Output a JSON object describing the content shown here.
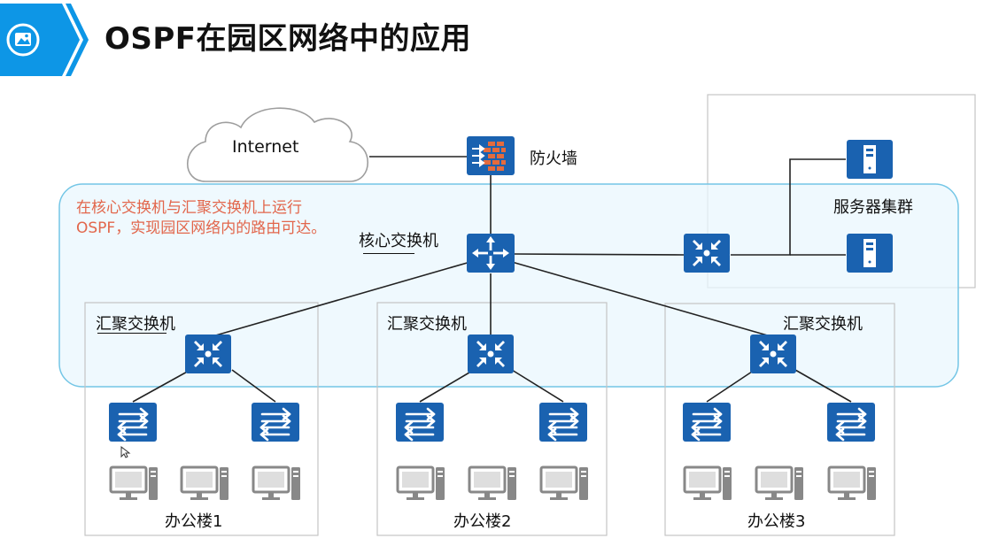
{
  "title": "OSPF在园区网络中的应用",
  "title_icon": "image-icon",
  "colors": {
    "accent": "#0d96e6",
    "device": "#1a62b0",
    "annotation": "#e2664b",
    "ospf_zone_fill": "#eaf7fd",
    "ospf_zone_border": "#74c6e6",
    "pc": "#888888"
  },
  "cloud": {
    "label": "Internet"
  },
  "firewall": {
    "label": "防火墙",
    "icon": "firewall-icon"
  },
  "core_switch": {
    "label": "核心交换机",
    "icon": "core-router-icon"
  },
  "server_cluster": {
    "label": "服务器集群",
    "icon": "server-icon"
  },
  "annotation": {
    "text": "在核心交换机与汇聚交换机上运行OSPF，实现园区网络内的路由可达。"
  },
  "buildings": [
    {
      "label": "办公楼1",
      "agg_label": "汇聚交换机"
    },
    {
      "label": "办公楼2",
      "agg_label": "汇聚交换机"
    },
    {
      "label": "办公楼3",
      "agg_label": "汇聚交换机"
    }
  ]
}
